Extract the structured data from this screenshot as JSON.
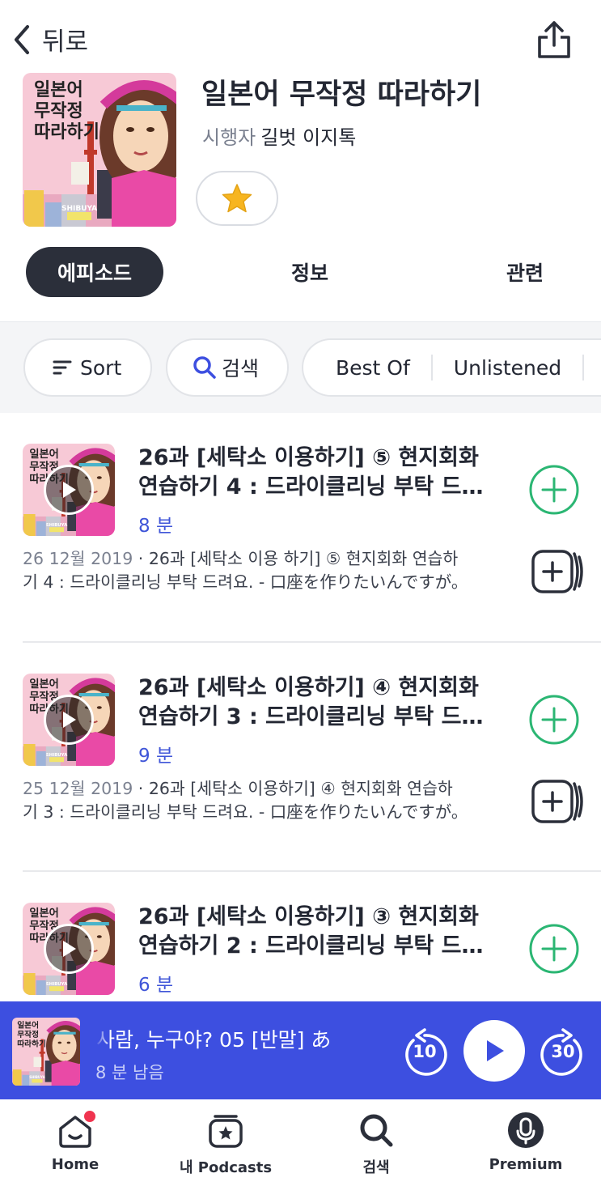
{
  "header": {
    "back_label": "뒤로",
    "share_icon": "share-icon"
  },
  "show": {
    "title": "일본어 무작정 따라하기",
    "author_label": "시행자",
    "author_name": "길벗 이지톡",
    "cover_text": [
      "일본어",
      "무작정",
      "따라하기"
    ],
    "cover_small": "SHIBUYA",
    "favorite_icon": "star-icon"
  },
  "tabs": [
    {
      "label": "에피소드",
      "active": true
    },
    {
      "label": "정보",
      "active": false
    },
    {
      "label": "관련",
      "active": false
    }
  ],
  "filters": {
    "sort": "Sort",
    "search": "검색",
    "best_of": "Best Of",
    "unlistened": "Unlistened"
  },
  "episodes": [
    {
      "title_line1": "26과 [세탁소 이용하기] ⑤ 현지회화",
      "title_line2": "연습하기 4 : 드라이클리닝 부탁 드…",
      "duration": "8 분",
      "date": "26 12월 2019",
      "desc_line1": "26과 [세탁소 이용 하기] ⑤ 현지회화 연습하",
      "desc_line2": "기 4 : 드라이클리닝 부탁 드려요. - 口座を作りたいんですが。"
    },
    {
      "title_line1": "26과 [세탁소 이용하기] ④ 현지회화",
      "title_line2": "연습하기 3 : 드라이클리닝 부탁 드…",
      "duration": "9 분",
      "date": "25 12월 2019",
      "desc_line1": "26과 [세탁소 이용하기] ④ 현지회화 연습하",
      "desc_line2": "기 3 : 드라이클리닝 부탁 드려요. - 口座を作りたいんですが。"
    },
    {
      "title_line1": "26과 [세탁소 이용하기] ③ 현지회화",
      "title_line2": "연습하기 2 : 드라이클리닝 부탁 드…",
      "duration": "6 분"
    }
  ],
  "player": {
    "title_scroll": "ㅓ 사람, 누구야?      05 [반말] あ",
    "remaining": "8 분 남음",
    "skip_back": "10",
    "skip_forward": "30",
    "accent": "#3d4fe0"
  },
  "nav": [
    {
      "label": "Home",
      "icon": "home-icon",
      "badge": true
    },
    {
      "label": "내 Podcasts",
      "icon": "my-podcasts-icon",
      "badge": false
    },
    {
      "label": "검색",
      "icon": "search-icon",
      "badge": false
    },
    {
      "label": "Premium",
      "icon": "premium-mic-icon",
      "badge": false
    }
  ]
}
